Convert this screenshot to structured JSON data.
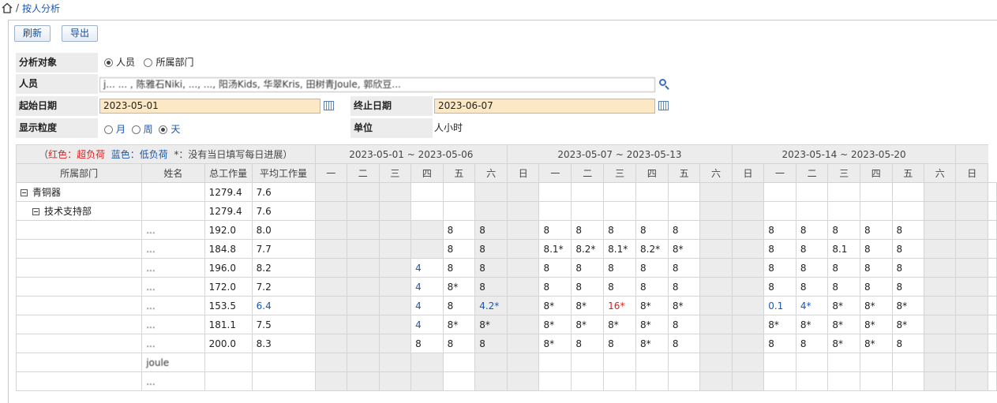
{
  "breadcrumb": {
    "sep": "/",
    "current": "按人分析"
  },
  "toolbar": {
    "refresh": "刷新",
    "export": "导出"
  },
  "form": {
    "target_label": "分析对象",
    "target_opt1": "人员",
    "target_opt2": "所属部门",
    "person_label": "人员",
    "person_value": "j...  ...     , 陈雅石Niki, ...,  ..., 阳汤Kids, 华翠Kris, 田树青Joule, 郭欣豆...",
    "start_label": "起始日期",
    "start_value": "2023-05-01",
    "end_label": "终止日期",
    "end_value": "2023-06-07",
    "gran_label": "显示粒度",
    "gran_opt1": "月",
    "gran_opt2": "周",
    "gran_opt3": "天",
    "unit_label": "单位",
    "unit_value": "人小时"
  },
  "legend": {
    "open": "（",
    "red": "红色：超负荷",
    "blue": "蓝色：低负荷",
    "star": "*：没有当日填写每日进展）"
  },
  "weeks": [
    "2023-05-01 ~ 2023-05-06",
    "2023-05-07 ~ 2023-05-13",
    "2023-05-14 ~ 2023-05-20"
  ],
  "headers": {
    "dept": "所属部门",
    "name": "姓名",
    "total": "总工作量",
    "avg": "平均工作量"
  },
  "day_headers": [
    "一",
    "二",
    "三",
    "四",
    "五",
    "六",
    "日",
    "一",
    "二",
    "三",
    "四",
    "五",
    "六",
    "日",
    "一",
    "二",
    "三",
    "四",
    "五",
    "六",
    "日"
  ],
  "rows": [
    {
      "dept": "青铜器",
      "level": 0,
      "name": "",
      "total": "1279.4",
      "avg": "7.6",
      "days": [
        "",
        "",
        "",
        "",
        "",
        "",
        "",
        "",
        "",
        "",
        "",
        "",
        "",
        "",
        "",
        "",
        "",
        "",
        "",
        "",
        ""
      ]
    },
    {
      "dept": "技术支持部",
      "level": 1,
      "name": "",
      "total": "1279.4",
      "avg": "7.6",
      "days": [
        "",
        "",
        "",
        "",
        "",
        "",
        "",
        "",
        "",
        "",
        "",
        "",
        "",
        "",
        "",
        "",
        "",
        "",
        "",
        "",
        ""
      ]
    },
    {
      "dept": "",
      "name": "...",
      "total": "192.0",
      "avg": "8.0",
      "days": [
        "",
        "",
        "",
        "",
        "8",
        "8",
        "",
        "8",
        "8",
        "8",
        "8",
        "8",
        "",
        "",
        "8",
        "8",
        "8",
        "8",
        "8",
        "",
        ""
      ]
    },
    {
      "dept": "",
      "name": "...",
      "total": "184.8",
      "avg": "7.7",
      "days": [
        "",
        "",
        "",
        "",
        "8",
        "8",
        "",
        "8.1*",
        "8.2*",
        "8.1*",
        "8.2*",
        "8*",
        "",
        "",
        "8",
        "8",
        "8.1",
        "8",
        "8",
        "",
        ""
      ]
    },
    {
      "dept": "",
      "name": "...",
      "total": "196.0",
      "avg": "8.2",
      "days": [
        "",
        "",
        "",
        "4",
        "8",
        "8",
        "",
        "8",
        "8",
        "8",
        "8",
        "8",
        "",
        "",
        "8",
        "8",
        "8",
        "8",
        "8",
        "",
        ""
      ]
    },
    {
      "dept": "",
      "name": "...",
      "total": "172.0",
      "avg": "7.2",
      "days": [
        "",
        "",
        "",
        "4",
        "8*",
        "8",
        "",
        "8",
        "8",
        "8",
        "8",
        "8",
        "",
        "",
        "8",
        "8",
        "8",
        "8",
        "8",
        "",
        ""
      ]
    },
    {
      "dept": "",
      "name": "...",
      "total": "153.5",
      "avg": "6.4",
      "days": [
        "",
        "",
        "",
        "4",
        "8",
        "4.2*",
        "",
        "8*",
        "8*",
        "16*",
        "8*",
        "8*",
        "",
        "",
        "0.1",
        "4*",
        "8*",
        "8*",
        "8*",
        "",
        ""
      ]
    },
    {
      "dept": "",
      "name": "...",
      "total": "181.1",
      "avg": "7.5",
      "days": [
        "",
        "",
        "",
        "4",
        "8*",
        "8*",
        "",
        "8*",
        "8*",
        "8*",
        "8*",
        "8",
        "",
        "",
        "8*",
        "8*",
        "8*",
        "8*",
        "8*",
        "",
        ""
      ]
    },
    {
      "dept": "",
      "name": "...",
      "total": "200.0",
      "avg": "8.3",
      "days": [
        "",
        "",
        "",
        "8",
        "8",
        "8",
        "",
        "8*",
        "8",
        "8",
        "8*",
        "8",
        "",
        "",
        "8",
        "8",
        "8*",
        "8*",
        "8",
        "",
        ""
      ]
    },
    {
      "dept": "",
      "name": "joule",
      "total": "",
      "avg": "",
      "days": [
        "",
        "",
        "",
        "",
        "",
        "",
        "",
        "",
        "",
        "",
        "",
        "",
        "",
        "",
        "",
        "",
        "",
        "",
        "",
        "",
        ""
      ]
    },
    {
      "dept": "",
      "name": "...",
      "total": "",
      "avg": "",
      "days": [
        "",
        "",
        "",
        "",
        "",
        "",
        "",
        "",
        "",
        "",
        "",
        "",
        "",
        "",
        "",
        "",
        "",
        "",
        "",
        "",
        ""
      ]
    }
  ],
  "styles": {
    "blue_cells": [
      "4:3",
      "5:3",
      "6:3",
      "7:3",
      "6:5",
      "6:14",
      "6:15"
    ],
    "blue_avg": [
      6
    ],
    "red_cells": [
      "6:9"
    ]
  }
}
